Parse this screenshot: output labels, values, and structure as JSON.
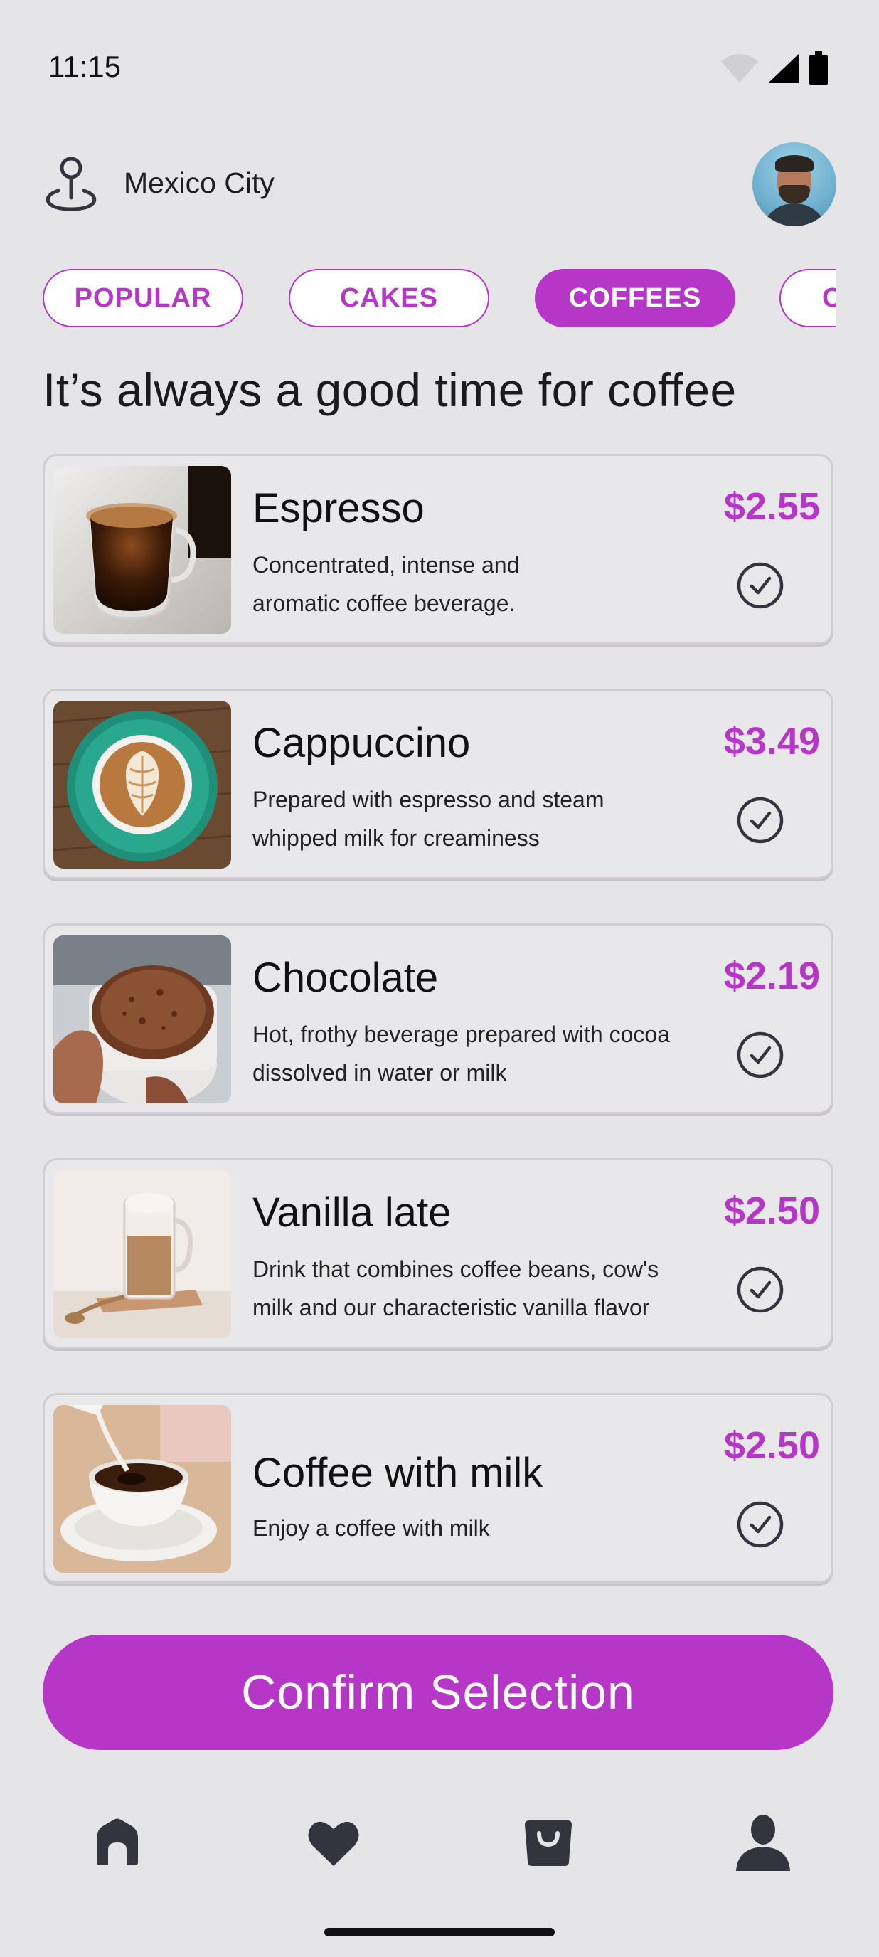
{
  "status_bar": {
    "time": "11:15"
  },
  "header": {
    "location": "Mexico City",
    "icons": [
      "location-pin-icon",
      "avatar"
    ]
  },
  "tabs": [
    {
      "label": "POPULAR",
      "active": false
    },
    {
      "label": "CAKES",
      "active": false
    },
    {
      "label": "COFFEES",
      "active": true
    },
    {
      "label": "C",
      "active": false
    }
  ],
  "heading": "It’s always a good time for coffee",
  "products": [
    {
      "name": "Espresso",
      "price": "$2.55",
      "description": "Concentrated, intense and aromatic coffee beverage."
    },
    {
      "name": "Cappuccino",
      "price": "$3.49",
      "description": "Prepared with espresso and steam whipped milk for creaminess"
    },
    {
      "name": "Chocolate",
      "price": "$2.19",
      "description": "Hot, frothy beverage prepared with cocoa dissolved in water or milk"
    },
    {
      "name": "Vanilla late",
      "price": "$2.50",
      "description": "Drink that combines  coffee beans, cow's milk and our characteristic vanilla flavor"
    },
    {
      "name": "Coffee with milk",
      "price": "$2.50",
      "description": "Enjoy a coffee with milk"
    }
  ],
  "cta_label": "Confirm Selection",
  "nav": [
    "home-icon",
    "heart-icon",
    "bag-icon",
    "profile-icon"
  ],
  "colors": {
    "accent": "#b536c7",
    "background": "#e5e4e6",
    "icon": "#34343f"
  }
}
